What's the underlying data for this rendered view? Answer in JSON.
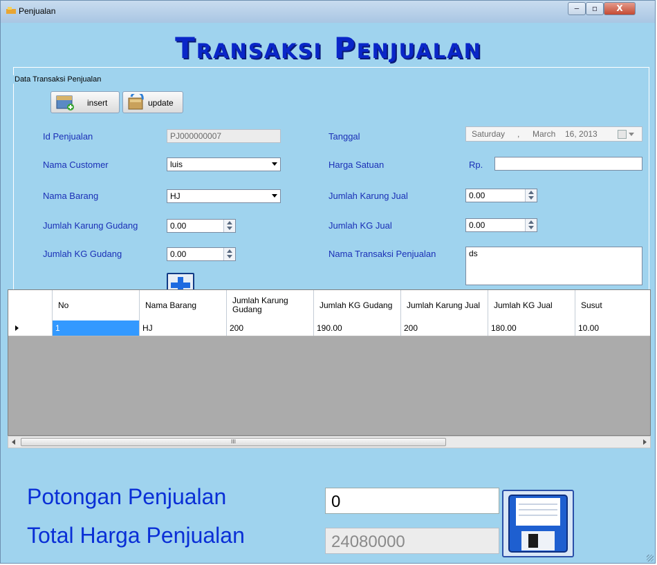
{
  "window": {
    "title": "Penjualan",
    "minimize_icon": "minimize-icon",
    "maximize_icon": "maximize-icon",
    "close_icon": "close-icon",
    "close_label": "X"
  },
  "header": {
    "title": "Transaksi Penjualan"
  },
  "group": {
    "label": "Data Transaksi Penjualan"
  },
  "toolbar": {
    "insert_label": "insert",
    "update_label": "update"
  },
  "form": {
    "id_penjualan_label": "Id Penjualan",
    "id_penjualan_value": "PJ000000007",
    "nama_customer_label": "Nama Customer",
    "nama_customer_value": "luis",
    "nama_barang_label": "Nama Barang",
    "nama_barang_value": "HJ",
    "jumlah_karung_gudang_label": "Jumlah Karung Gudang",
    "jumlah_karung_gudang_value": "0.00",
    "jumlah_kg_gudang_label": "Jumlah KG Gudang",
    "jumlah_kg_gudang_value": "0.00",
    "tanggal_label": "Tanggal",
    "tanggal_day": "Saturday",
    "tanggal_sep": ",",
    "tanggal_month": "March",
    "tanggal_date": "16, 2013",
    "harga_satuan_label": "Harga Satuan",
    "harga_satuan_prefix": "Rp.",
    "harga_satuan_value": "",
    "jumlah_karung_jual_label": "Jumlah Karung Jual",
    "jumlah_karung_jual_value": "0.00",
    "jumlah_kg_jual_label": "Jumlah KG Jual",
    "jumlah_kg_jual_value": "0.00",
    "nama_transaksi_label": "Nama Transaksi Penjualan",
    "nama_transaksi_value": "ds"
  },
  "grid": {
    "columns": [
      "No",
      "Nama Barang",
      "Jumlah Karung Gudang",
      "Jumlah KG Gudang",
      "Jumlah Karung Jual",
      "Jumlah KG Jual",
      "Susut"
    ],
    "rows": [
      [
        "1",
        "HJ",
        "200",
        "190.00",
        "200",
        "180.00",
        "10.00"
      ]
    ],
    "scroll_thumb_grip": "III"
  },
  "footer": {
    "potongan_label": "Potongan Penjualan",
    "potongan_value": "0",
    "total_label": "Total Harga Penjualan",
    "total_value": "24080000",
    "save_icon": "floppy-disk-icon"
  },
  "colors": {
    "background": "#9fd3ee",
    "title": "#0a26c8",
    "label": "#1a2fb6",
    "selection": "#3399ff"
  }
}
